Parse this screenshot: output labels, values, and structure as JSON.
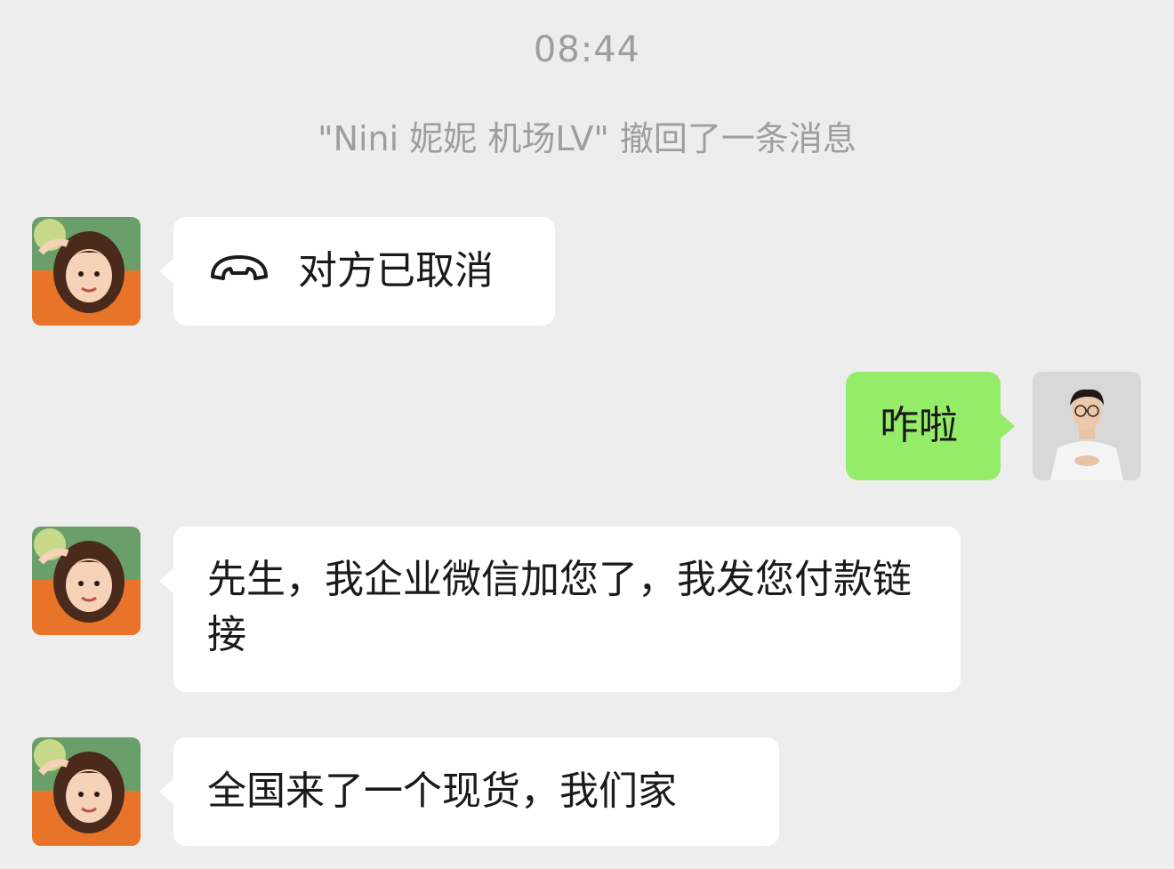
{
  "chat": {
    "timestamp": "08:44",
    "recall_notice": "\"Nini 妮妮 机场LV\" 撤回了一条消息",
    "messages": [
      {
        "side": "left",
        "type": "call",
        "icon": "phone-hangup-icon",
        "text": "对方已取消"
      },
      {
        "side": "right",
        "type": "text",
        "text": "咋啦"
      },
      {
        "side": "left",
        "type": "text",
        "text": "先生，我企业微信加您了，我发您付款链接"
      },
      {
        "side": "left",
        "type": "text",
        "text": "全国来了一个现货，我们家"
      }
    ]
  },
  "colors": {
    "background": "#ededed",
    "incoming_bubble": "#ffffff",
    "outgoing_bubble": "#95ec69",
    "meta_text": "#9e9e9e"
  }
}
